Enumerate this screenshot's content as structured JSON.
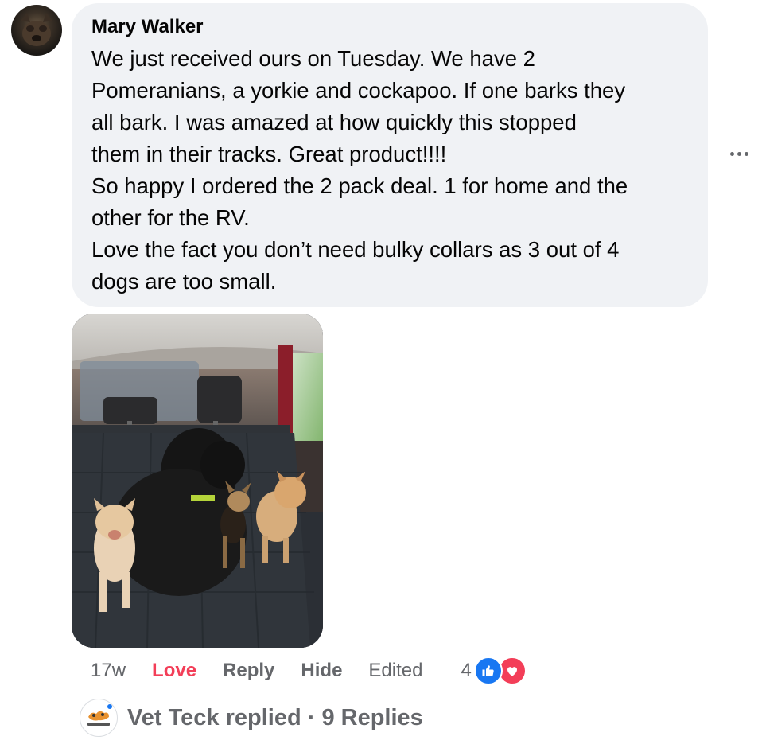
{
  "comment": {
    "author": "Mary Walker",
    "lines": [
      "We just received ours on Tuesday. We have 2",
      "Pomeranians, a yorkie and cockapoo. If one barks they",
      "all bark. I was amazed at how quickly this stopped",
      "them in their tracks. Great product!!!!",
      "So happy I ordered the 2 pack deal. 1 for home and the",
      "other for the RV.",
      "Love the fact you don’t need bulky collars as 3 out of 4",
      "dogs are too small."
    ]
  },
  "actions": {
    "time": "17w",
    "love": "Love",
    "reply": "Reply",
    "hide": "Hide",
    "edited": "Edited",
    "reaction_count": "4"
  },
  "replies": {
    "summary": "Vet Teck replied · 9 Replies"
  },
  "icons": {
    "more": "more-options-icon",
    "like": "like-icon",
    "love": "heart-icon"
  },
  "colors": {
    "bubble": "#f0f2f5",
    "love": "#f33e58",
    "like": "#1877f2",
    "muted": "#65676b"
  }
}
